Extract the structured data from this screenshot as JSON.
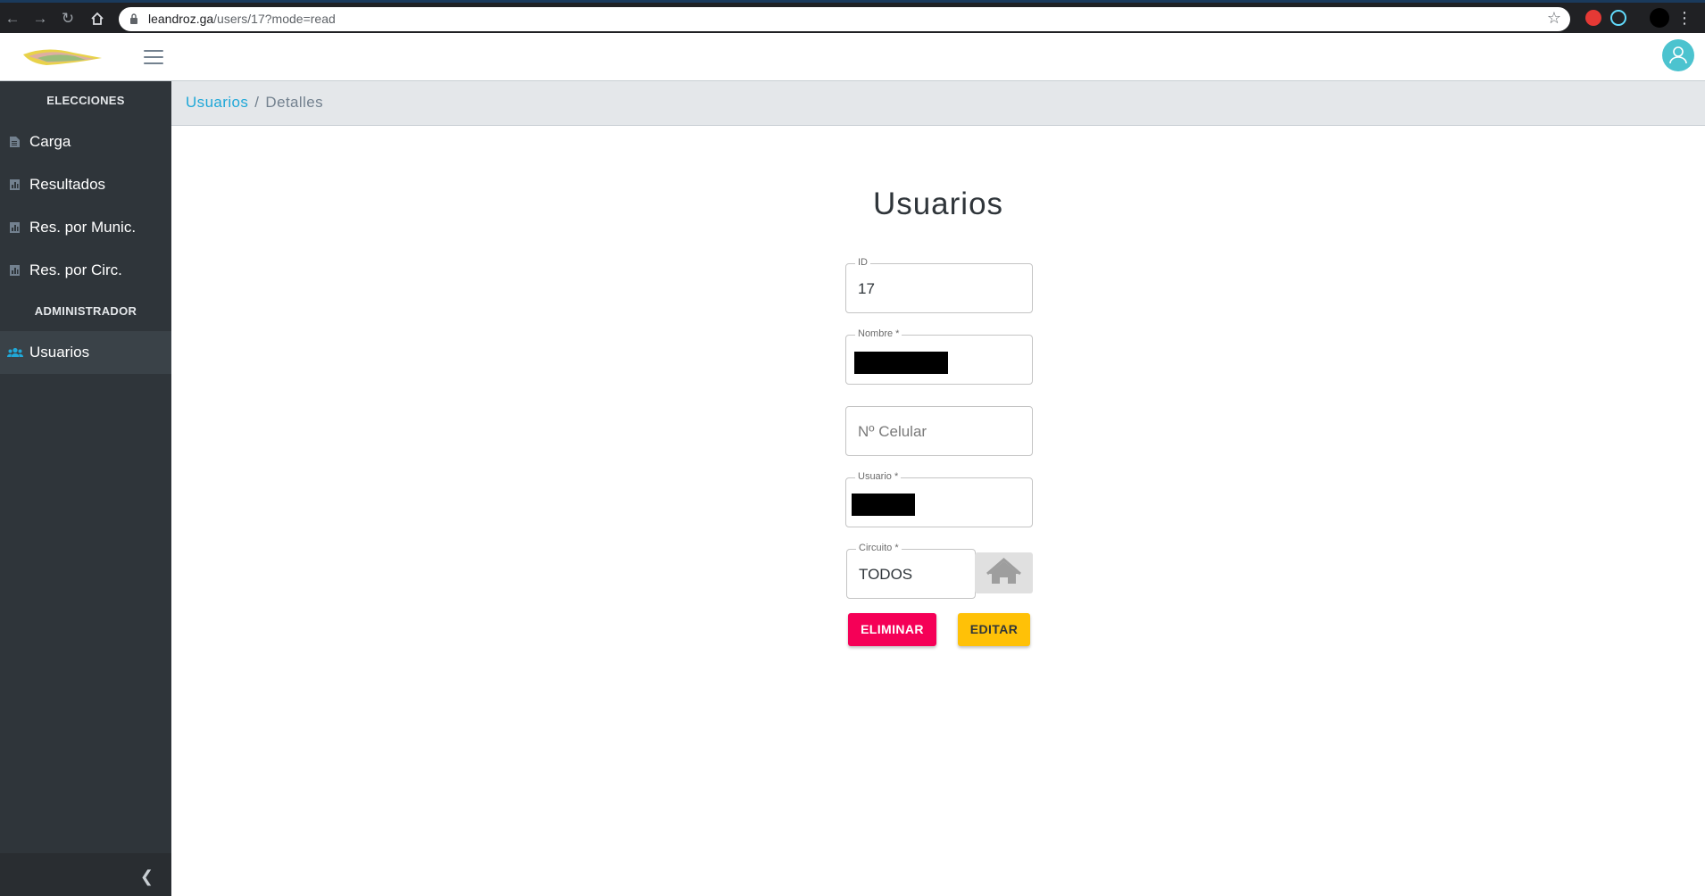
{
  "browser": {
    "url_host": "leandroz.ga",
    "url_path": "/users/17?mode=read"
  },
  "sidebar": {
    "section_elecciones": "ELECCIONES",
    "items": [
      {
        "label": "Carga",
        "icon": "file-icon"
      },
      {
        "label": "Resultados",
        "icon": "chart-icon"
      },
      {
        "label": "Res. por Munic.",
        "icon": "chart-icon"
      },
      {
        "label": "Res. por Circ.",
        "icon": "chart-icon"
      }
    ],
    "section_admin": "ADMINISTRADOR",
    "admin_items": [
      {
        "label": "Usuarios",
        "icon": "users-icon"
      }
    ]
  },
  "breadcrumb": {
    "link": "Usuarios",
    "separator": "/",
    "current": "Detalles"
  },
  "form": {
    "title": "Usuarios",
    "id_label": "ID",
    "id_value": "17",
    "nombre_label": "Nombre *",
    "celular_placeholder": "Nº Celular",
    "usuario_label": "Usuario *",
    "circuito_label": "Circuito *",
    "circuito_value": "TODOS",
    "delete_label": "ELIMINAR",
    "edit_label": "EDITAR"
  },
  "colors": {
    "sidebar_bg": "#2f353a",
    "accent": "#20a8d8",
    "delete": "#f50057",
    "edit": "#ffc107",
    "avatar": "#4cc3cf"
  }
}
